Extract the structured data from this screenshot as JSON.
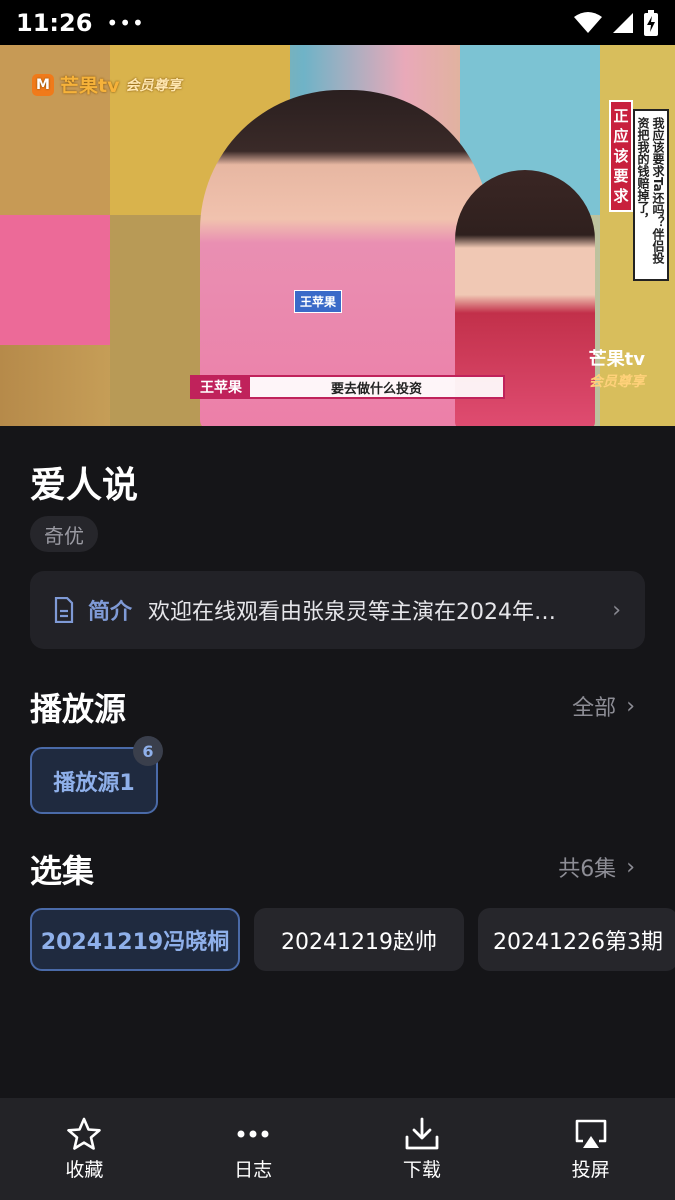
{
  "status_bar": {
    "time": "11:26",
    "more": "•••"
  },
  "video": {
    "logo_main": "芒果tv",
    "logo_sub": "会员尊享",
    "caption_red": "正应该要求",
    "caption_white": "我应该要求Ta还吗？伴侣投资把我的钱赔掉了，",
    "name_tag_shirt": "王苹果",
    "subtitle_name": "王苹果",
    "subtitle_text": "要去做什么投资"
  },
  "title": "爱人说",
  "tag": "奇优",
  "intro": {
    "label": "简介",
    "text": "欢迎在线观看由张泉灵等主演在2024年…"
  },
  "sources": {
    "title": "播放源",
    "more": "全部",
    "items": [
      {
        "label": "播放源1",
        "badge": "6"
      }
    ]
  },
  "episodes": {
    "title": "选集",
    "count": "共6集",
    "items": [
      {
        "label": "20241219冯晓桐"
      },
      {
        "label": "20241219赵帅"
      },
      {
        "label": "20241226第3期"
      }
    ]
  },
  "bottom_bar": {
    "items": [
      {
        "label": "收藏",
        "icon": "star-icon"
      },
      {
        "label": "日志",
        "icon": "more-icon"
      },
      {
        "label": "下载",
        "icon": "download-icon"
      },
      {
        "label": "投屏",
        "icon": "cast-icon"
      }
    ]
  },
  "colors": {
    "accent": "#8fb0ea",
    "accent_border": "#4a6aa8",
    "background": "#151518",
    "card": "#222227"
  }
}
